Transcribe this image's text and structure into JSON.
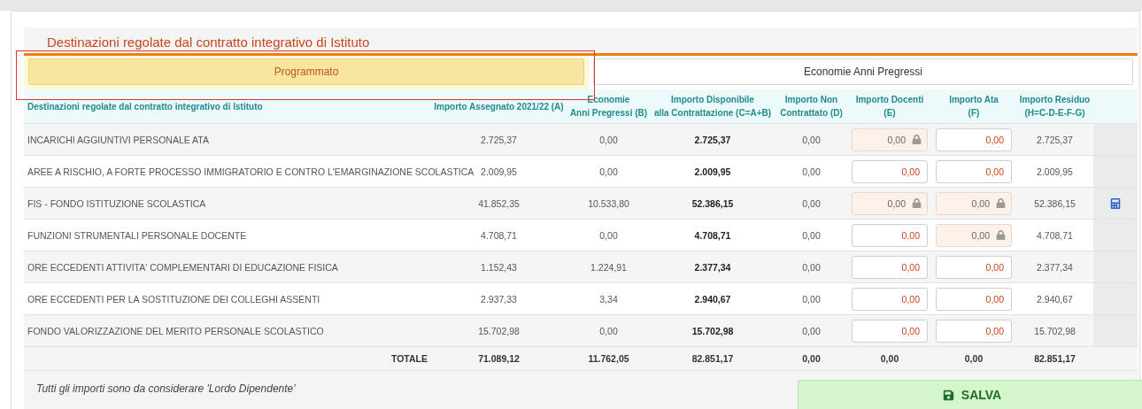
{
  "section_title": "Destinazioni regolate dal contratto integrativo di Istituto",
  "tabs": [
    {
      "label": "Programmato",
      "selected": true
    },
    {
      "label": "Economie Anni Pregressi",
      "selected": false
    }
  ],
  "table": {
    "columns": [
      {
        "lines": [
          "Destinazioni regolate dal contratto integrativo di Istituto"
        ]
      },
      {
        "lines": [
          "Importo Assegnato 2021/22 (A)"
        ]
      },
      {
        "lines": [
          "Economie",
          "Anni Pregressi (B)"
        ]
      },
      {
        "lines": [
          "Importo Disponibile",
          "alla Contrattazione (C=A+B)"
        ]
      },
      {
        "lines": [
          "Importo Non",
          "Contrattato (D)"
        ]
      },
      {
        "lines": [
          "Importo Docenti",
          "(E)"
        ]
      },
      {
        "lines": [
          "Importo Ata",
          "(F)"
        ]
      },
      {
        "lines": [
          "Importo Residuo",
          "(H=C-D-E-F-G)"
        ]
      }
    ],
    "rows": [
      {
        "name": "INCARICHI AGGIUNTIVI PERSONALE ATA",
        "assegnato": "2.725,37",
        "economie": "0,00",
        "disponibile": "2.725,37",
        "non_contrattato": "0,00",
        "docenti": {
          "value": "0,00",
          "locked": true
        },
        "ata": {
          "value": "0,00",
          "locked": false
        },
        "residuo": "2.725,37",
        "calculator": false
      },
      {
        "name": "AREE A RISCHIO, A FORTE PROCESSO IMMIGRATORIO E CONTRO L'EMARGINAZIONE SCOLASTICA",
        "assegnato": "2.009,95",
        "economie": "0,00",
        "disponibile": "2.009,95",
        "non_contrattato": "0,00",
        "docenti": {
          "value": "0,00",
          "locked": false
        },
        "ata": {
          "value": "0,00",
          "locked": false
        },
        "residuo": "2.009,95",
        "calculator": false
      },
      {
        "name": "FIS - FONDO ISTITUZIONE SCOLASTICA",
        "assegnato": "41.852,35",
        "economie": "10.533,80",
        "disponibile": "52.386,15",
        "non_contrattato": "0,00",
        "docenti": {
          "value": "0,00",
          "locked": true
        },
        "ata": {
          "value": "0,00",
          "locked": true
        },
        "residuo": "52.386,15",
        "calculator": true
      },
      {
        "name": "FUNZIONI STRUMENTALI PERSONALE DOCENTE",
        "assegnato": "4.708,71",
        "economie": "0,00",
        "disponibile": "4.708,71",
        "non_contrattato": "0,00",
        "docenti": {
          "value": "0,00",
          "locked": false
        },
        "ata": {
          "value": "0,00",
          "locked": true
        },
        "residuo": "4.708,71",
        "calculator": false
      },
      {
        "name": "ORE ECCEDENTI ATTIVITA' COMPLEMENTARI DI EDUCAZIONE FISICA",
        "assegnato": "1.152,43",
        "economie": "1.224,91",
        "disponibile": "2.377,34",
        "non_contrattato": "0,00",
        "docenti": {
          "value": "0,00",
          "locked": false
        },
        "ata": {
          "value": "0,00",
          "locked": false
        },
        "residuo": "2.377,34",
        "calculator": false
      },
      {
        "name": "ORE ECCEDENTI PER LA SOSTITUZIONE DEI COLLEGHI ASSENTI",
        "assegnato": "2.937,33",
        "economie": "3,34",
        "disponibile": "2.940,67",
        "non_contrattato": "0,00",
        "docenti": {
          "value": "0,00",
          "locked": false
        },
        "ata": {
          "value": "0,00",
          "locked": false
        },
        "residuo": "2.940,67",
        "calculator": false
      },
      {
        "name": "FONDO VALORIZZAZIONE DEL MERITO PERSONALE SCOLASTICO",
        "assegnato": "15.702,98",
        "economie": "0,00",
        "disponibile": "15.702,98",
        "non_contrattato": "0,00",
        "docenti": {
          "value": "0,00",
          "locked": false
        },
        "ata": {
          "value": "0,00",
          "locked": false
        },
        "residuo": "15.702,98",
        "calculator": false
      }
    ],
    "total": {
      "label": "TOTALE",
      "values": [
        "71.089,12",
        "11.762,05",
        "82.851,17",
        "0,00",
        "0,00",
        "0,00",
        "82.851,17"
      ]
    }
  },
  "note": "Tutti gli importi sono da considerare 'Lordo Dipendente'",
  "save_button": "SALVA"
}
